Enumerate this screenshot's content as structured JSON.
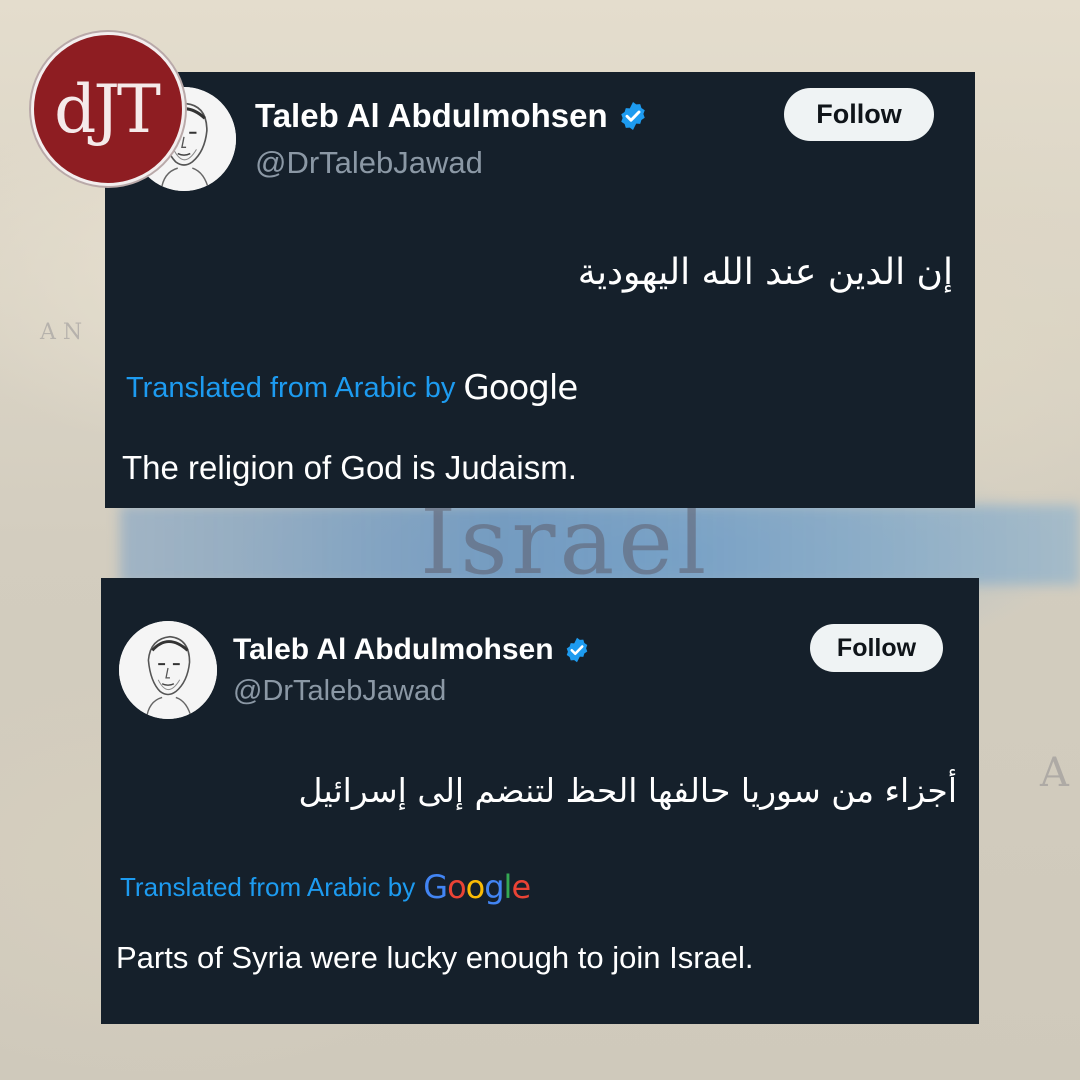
{
  "logo": {
    "text": "dJT"
  },
  "background": {
    "map_label": "Israel"
  },
  "tweets": [
    {
      "display_name": "Taleb Al Abdulmohsen",
      "handle": "@DrTalebJawad",
      "verified": true,
      "follow_label": "Follow",
      "original_text": "إن الدين عند الله اليهودية",
      "translated_label": "Translated from Arabic by",
      "translator": "Google",
      "translation": "The religion of God is Judaism."
    },
    {
      "display_name": "Taleb Al Abdulmohsen",
      "handle": "@DrTalebJawad",
      "verified": true,
      "follow_label": "Follow",
      "original_text": "أجزاء من سوريا حالفها الحظ لتنضم إلى إسرائيل",
      "translated_label": "Translated from Arabic by",
      "translator": "Google",
      "translation": "Parts of Syria were lucky enough to join Israel."
    }
  ],
  "colors": {
    "card_bg": "#15202b",
    "link_blue": "#1d9bf0",
    "verified_blue": "#1d9bf0",
    "logo_red": "#8e1d22",
    "google_blue": "#4285f4",
    "google_red": "#ea4335",
    "google_yellow": "#fbbc05",
    "google_green": "#34a853"
  }
}
